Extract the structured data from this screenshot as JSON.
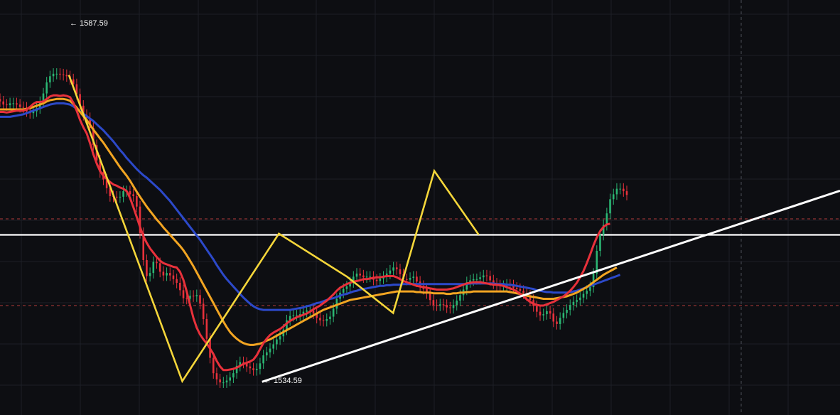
{
  "chart_data": {
    "type": "candlestick",
    "title": "",
    "xlabel": "",
    "ylabel": "",
    "ylim": [
      1530.5,
      1598.0
    ],
    "grid": true,
    "legend": "none",
    "annotations": {
      "high_label": "← 1587.59",
      "low_label": "← 1534.59",
      "high_value": 1587.59,
      "low_value": 1534.59
    },
    "candle_closes": [
      1581.5,
      1581.0,
      1580.9,
      1581.2,
      1581.2,
      1581.0,
      1580.6,
      1580.5,
      1579.9,
      1579.6,
      1579.9,
      1580.4,
      1581.4,
      1582.8,
      1584.6,
      1585.6,
      1586.0,
      1586.0,
      1585.9,
      1585.8,
      1585.6,
      1585.1,
      1584.3,
      1582.7,
      1580.8,
      1579.3,
      1578.8,
      1577.2,
      1574.4,
      1571.9,
      1570.0,
      1568.8,
      1567.4,
      1566.1,
      1566.0,
      1565.9,
      1566.0,
      1566.9,
      1566.9,
      1566.4,
      1566.1,
      1564.4,
      1560.1,
      1555.7,
      1553.1,
      1553.6,
      1555.4,
      1555.2,
      1553.8,
      1553.2,
      1553.6,
      1553.2,
      1552.6,
      1552.0,
      1550.8,
      1549.5,
      1549.4,
      1549.9,
      1549.8,
      1550.0,
      1548.6,
      1546.1,
      1542.9,
      1539.8,
      1537.3,
      1536.3,
      1535.8,
      1535.8,
      1536.1,
      1536.6,
      1537.3,
      1538.5,
      1539.1,
      1539.0,
      1538.4,
      1538.1,
      1537.8,
      1538.0,
      1538.9,
      1540.2,
      1540.7,
      1541.3,
      1542.0,
      1542.8,
      1543.3,
      1544.4,
      1545.9,
      1546.6,
      1546.7,
      1546.7,
      1546.9,
      1547.3,
      1547.5,
      1547.5,
      1547.0,
      1546.3,
      1545.9,
      1545.8,
      1546.1,
      1546.5,
      1547.8,
      1549.4,
      1550.4,
      1551.0,
      1551.4,
      1552.1,
      1553.0,
      1553.5,
      1553.2,
      1552.9,
      1553.0,
      1553.0,
      1552.5,
      1552.3,
      1552.7,
      1553.0,
      1553.5,
      1554.0,
      1554.5,
      1554.2,
      1553.4,
      1552.6,
      1552.5,
      1552.8,
      1553.0,
      1552.2,
      1551.5,
      1551.0,
      1550.3,
      1549.2,
      1548.4,
      1548.3,
      1548.5,
      1548.4,
      1548.0,
      1547.9,
      1548.4,
      1549.1,
      1550.0,
      1550.9,
      1552.1,
      1552.4,
      1552.6,
      1552.6,
      1552.9,
      1553.2,
      1553.1,
      1552.4,
      1551.9,
      1551.6,
      1551.5,
      1551.5,
      1551.7,
      1551.6,
      1551.2,
      1551.0,
      1550.7,
      1550.3,
      1549.9,
      1549.2,
      1548.2,
      1547.3,
      1546.7,
      1546.9,
      1547.4,
      1547.0,
      1545.7,
      1545.3,
      1546.3,
      1547.1,
      1547.6,
      1548.4,
      1548.9,
      1549.2,
      1549.6,
      1550.2,
      1550.7,
      1551.3,
      1553.5,
      1557.2,
      1559.8,
      1561.4,
      1563.3,
      1565.6,
      1566.4,
      1567.3,
      1567.3,
      1566.9,
      1566.3
    ],
    "series": [
      {
        "name": "",
        "color": "#e8313b",
        "values": [
          1579.8,
          1579.8,
          1579.7,
          1579.8,
          1579.9,
          1580.0,
          1580.0,
          1580.0,
          1580.2,
          1580.6,
          1581.1,
          1581.4,
          1581.4,
          1581.5,
          1581.9,
          1582.3,
          1582.5,
          1582.5,
          1582.4,
          1582.5,
          1582.4,
          1582.2,
          1581.3,
          1580.0,
          1578.5,
          1577.3,
          1576.3,
          1574.7,
          1572.9,
          1571.4,
          1570.2,
          1569.4,
          1568.9,
          1568.4,
          1568.0,
          1567.8,
          1567.5,
          1567.3,
          1566.9,
          1565.8,
          1564.3,
          1562.7,
          1561.1,
          1559.6,
          1558.5,
          1557.6,
          1556.9,
          1556.2,
          1555.6,
          1555.2,
          1555.0,
          1554.8,
          1554.6,
          1554.5,
          1553.8,
          1552.5,
          1550.6,
          1548.4,
          1546.3,
          1544.7,
          1543.6,
          1542.8,
          1542.1,
          1541.3,
          1540.4,
          1539.3,
          1538.4,
          1537.8,
          1537.8,
          1537.9,
          1538.0,
          1538.2,
          1538.5,
          1538.8,
          1539.0,
          1539.2,
          1539.5,
          1540.2,
          1541.2,
          1542.2,
          1542.9,
          1543.5,
          1543.9,
          1544.2,
          1544.5,
          1544.9,
          1545.4,
          1545.8,
          1546.1,
          1546.4,
          1546.6,
          1546.8,
          1547.0,
          1547.3,
          1547.7,
          1548.0,
          1548.3,
          1548.7,
          1549.1,
          1549.6,
          1550.1,
          1550.7,
          1551.2,
          1551.5,
          1551.8,
          1552.0,
          1552.2,
          1552.3,
          1552.4,
          1552.6,
          1552.6,
          1552.7,
          1552.8,
          1552.9,
          1552.9,
          1553.0,
          1553.1,
          1553.1,
          1553.1,
          1552.9,
          1552.6,
          1552.3,
          1552.1,
          1551.9,
          1551.7,
          1551.5,
          1551.4,
          1551.3,
          1551.2,
          1551.1,
          1551.0,
          1550.9,
          1550.9,
          1550.9,
          1550.9,
          1551.0,
          1551.1,
          1551.3,
          1551.5,
          1551.7,
          1551.9,
          1552.0,
          1552.1,
          1552.1,
          1552.1,
          1552.0,
          1551.9,
          1551.8,
          1551.7,
          1551.7,
          1551.6,
          1551.5,
          1551.3,
          1551.1,
          1550.9,
          1550.6,
          1550.2,
          1549.8,
          1549.3,
          1548.9,
          1548.6,
          1548.4,
          1548.3,
          1548.3,
          1548.5,
          1548.7,
          1548.9,
          1549.2,
          1549.5,
          1549.8,
          1550.2,
          1550.7,
          1551.3,
          1552.0,
          1552.9,
          1553.9,
          1555.2,
          1556.6,
          1558.1,
          1559.4,
          1560.4,
          1561.1,
          1561.5,
          1561.6
        ]
      },
      {
        "name": "",
        "color": "#f2a522",
        "values": [
          1580.2,
          1580.2,
          1580.2,
          1580.2,
          1580.2,
          1580.2,
          1580.2,
          1580.2,
          1580.3,
          1580.4,
          1580.6,
          1580.8,
          1581.0,
          1581.2,
          1581.5,
          1581.7,
          1581.8,
          1581.9,
          1581.9,
          1581.9,
          1581.8,
          1581.6,
          1581.1,
          1580.5,
          1579.8,
          1579.1,
          1578.5,
          1577.7,
          1576.9,
          1576.2,
          1575.5,
          1574.8,
          1574.0,
          1573.2,
          1572.4,
          1571.6,
          1570.8,
          1570.1,
          1569.4,
          1568.6,
          1567.7,
          1566.8,
          1566.0,
          1565.2,
          1564.4,
          1563.7,
          1563.0,
          1562.3,
          1561.7,
          1561.0,
          1560.4,
          1559.8,
          1559.2,
          1558.6,
          1558.0,
          1557.3,
          1556.5,
          1555.6,
          1554.7,
          1553.7,
          1552.7,
          1551.7,
          1550.7,
          1549.7,
          1548.7,
          1547.7,
          1546.7,
          1545.7,
          1544.8,
          1544.0,
          1543.4,
          1542.9,
          1542.5,
          1542.2,
          1542.0,
          1541.9,
          1541.9,
          1542.0,
          1542.1,
          1542.3,
          1542.6,
          1542.8,
          1543.1,
          1543.4,
          1543.7,
          1544.0,
          1544.3,
          1544.6,
          1544.9,
          1545.2,
          1545.5,
          1545.8,
          1546.1,
          1546.4,
          1546.7,
          1547.0,
          1547.3,
          1547.6,
          1547.8,
          1548.0,
          1548.2,
          1548.4,
          1548.6,
          1548.8,
          1549.0,
          1549.2,
          1549.3,
          1549.4,
          1549.5,
          1549.6,
          1549.7,
          1549.8,
          1549.9,
          1550.0,
          1550.1,
          1550.2,
          1550.3,
          1550.4,
          1550.5,
          1550.6,
          1550.6,
          1550.6,
          1550.6,
          1550.6,
          1550.6,
          1550.5,
          1550.5,
          1550.4,
          1550.4,
          1550.4,
          1550.3,
          1550.3,
          1550.3,
          1550.3,
          1550.2,
          1550.2,
          1550.3,
          1550.3,
          1550.4,
          1550.4,
          1550.5,
          1550.5,
          1550.6,
          1550.6,
          1550.6,
          1550.6,
          1550.6,
          1550.6,
          1550.6,
          1550.6,
          1550.6,
          1550.6,
          1550.6,
          1550.5,
          1550.4,
          1550.3,
          1550.2,
          1550.0,
          1549.9,
          1549.8,
          1549.7,
          1549.6,
          1549.5,
          1549.4,
          1549.4,
          1549.4,
          1549.4,
          1549.5,
          1549.6,
          1549.7,
          1549.8,
          1550.0,
          1550.2,
          1550.4,
          1550.7,
          1551.0,
          1551.3,
          1551.7,
          1552.1,
          1552.5,
          1552.9,
          1553.3,
          1553.6,
          1553.9,
          1554.2,
          1554.5
        ]
      },
      {
        "name": "",
        "color": "#2c49c9",
        "values": [
          1579.0,
          1579.0,
          1579.0,
          1579.0,
          1579.1,
          1579.2,
          1579.3,
          1579.4,
          1579.6,
          1579.8,
          1580.0,
          1580.2,
          1580.4,
          1580.6,
          1580.8,
          1581.0,
          1581.1,
          1581.2,
          1581.2,
          1581.2,
          1581.1,
          1581.0,
          1580.7,
          1580.3,
          1579.9,
          1579.5,
          1579.1,
          1578.7,
          1578.3,
          1577.8,
          1577.3,
          1576.8,
          1576.2,
          1575.6,
          1575.0,
          1574.3,
          1573.6,
          1573.0,
          1572.3,
          1571.7,
          1571.1,
          1570.5,
          1570.0,
          1569.5,
          1569.1,
          1568.6,
          1568.1,
          1567.6,
          1567.1,
          1566.5,
          1565.9,
          1565.3,
          1564.6,
          1563.9,
          1563.2,
          1562.5,
          1561.8,
          1561.1,
          1560.4,
          1559.7,
          1559.0,
          1558.2,
          1557.4,
          1556.6,
          1555.8,
          1554.9,
          1554.1,
          1553.3,
          1552.6,
          1552.0,
          1551.4,
          1550.8,
          1550.2,
          1549.6,
          1549.1,
          1548.6,
          1548.2,
          1547.9,
          1547.7,
          1547.6,
          1547.6,
          1547.6,
          1547.6,
          1547.6,
          1547.6,
          1547.6,
          1547.6,
          1547.6,
          1547.7,
          1547.8,
          1547.9,
          1548.0,
          1548.2,
          1548.3,
          1548.5,
          1548.7,
          1548.8,
          1549.0,
          1549.2,
          1549.4,
          1549.5,
          1549.7,
          1549.9,
          1550.1,
          1550.2,
          1550.4,
          1550.6,
          1550.7,
          1550.9,
          1551.0,
          1551.1,
          1551.2,
          1551.3,
          1551.4,
          1551.5,
          1551.5,
          1551.6,
          1551.6,
          1551.7,
          1551.7,
          1551.7,
          1551.8,
          1551.8,
          1551.8,
          1551.8,
          1551.8,
          1551.8,
          1551.8,
          1551.8,
          1551.8,
          1551.8,
          1551.8,
          1551.8,
          1551.8,
          1551.8,
          1551.8,
          1551.8,
          1551.8,
          1551.8,
          1551.8,
          1551.8,
          1551.9,
          1551.9,
          1551.9,
          1551.9,
          1551.9,
          1551.9,
          1551.9,
          1551.9,
          1551.8,
          1551.8,
          1551.8,
          1551.7,
          1551.7,
          1551.6,
          1551.5,
          1551.4,
          1551.3,
          1551.2,
          1551.1,
          1551.0,
          1550.8,
          1550.7,
          1550.6,
          1550.5,
          1550.5,
          1550.4,
          1550.4,
          1550.4,
          1550.4,
          1550.4,
          1550.5,
          1550.6,
          1550.7,
          1550.9,
          1551.1,
          1551.3,
          1551.5,
          1551.7,
          1551.9,
          1552.1,
          1552.3,
          1552.5,
          1552.7,
          1552.9,
          1553.1,
          1553.3
        ]
      }
    ],
    "zigzag": {
      "color": "#f5d63a",
      "points": [
        [
          0.0,
          1585.8
        ],
        [
          0.135,
          1536.0
        ],
        [
          0.25,
          1560.0
        ],
        [
          0.331,
          1553.0
        ],
        [
          0.386,
          1547.1
        ],
        [
          0.435,
          1570.2
        ],
        [
          0.488,
          1559.8
        ]
      ]
    },
    "horizontal_levels": [
      {
        "value": 1559.8,
        "color": "#ffffff",
        "style": "solid"
      },
      {
        "value": 1562.4,
        "color": "#b23a3a",
        "style": "dashed"
      },
      {
        "value": 1548.3,
        "color": "#b23a3a",
        "style": "dashed"
      }
    ],
    "trendline": {
      "color": "#ffffff",
      "points": [
        [
          0.135,
          1535.9
        ],
        [
          0.6,
          1560.2
        ]
      ]
    },
    "colors": {
      "background": "#0d0e12",
      "up_candle": "#2bb673",
      "down_candle": "#e8313b"
    }
  }
}
